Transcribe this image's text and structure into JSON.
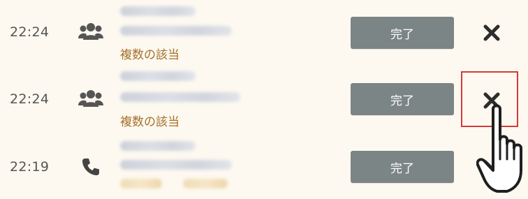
{
  "rows": [
    {
      "time": "22:24",
      "icon": "group-icon",
      "match_label": "複数の該当",
      "done_label": "完了",
      "close_icon": "close-icon"
    },
    {
      "time": "22:24",
      "icon": "group-icon",
      "match_label": "複数の該当",
      "done_label": "完了",
      "close_icon": "close-icon"
    },
    {
      "time": "22:19",
      "icon": "phone-icon",
      "done_label": "完了",
      "close_icon": "close-icon"
    }
  ],
  "overlay": {
    "highlight_color": "#d23a3a",
    "pointer_icon": "hand-pointer-icon"
  },
  "colors": {
    "background": "#fdf9f0",
    "divider": "#e6c47a",
    "button_bg": "#7c8585",
    "match_text": "#a5702a"
  }
}
